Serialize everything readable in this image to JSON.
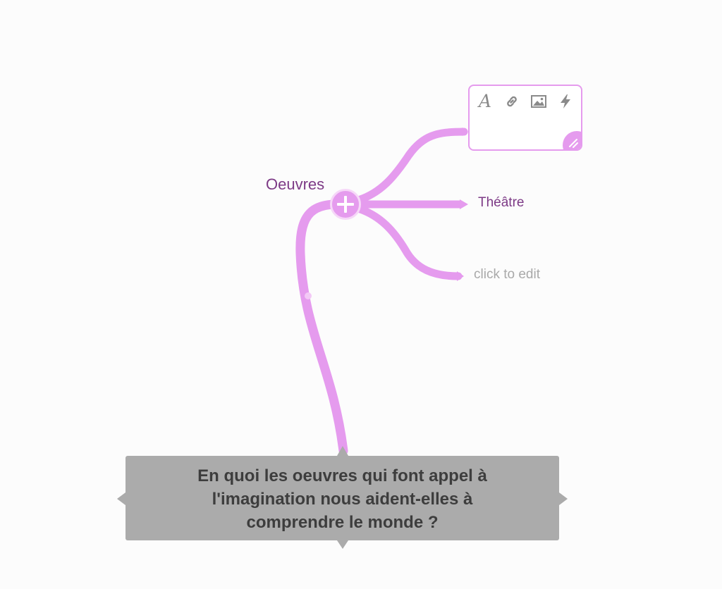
{
  "mindmap": {
    "branch_color": "#e59bee",
    "label_color": "#7d3a86",
    "central_topic": {
      "text": "En quoi les oeuvres qui font appel à\nl'imagination nous aident-elles à\ncomprendre le monde ?",
      "background": "#ababab",
      "text_color": "#3d3d3d"
    },
    "branch": {
      "label": "Oeuvres",
      "expand_icon": "plus-icon",
      "children": [
        {
          "type": "editing",
          "toolbar": [
            {
              "name": "text-style-icon",
              "glyph": "A"
            },
            {
              "name": "link-icon"
            },
            {
              "name": "image-icon"
            },
            {
              "name": "lightning-icon"
            }
          ],
          "resize_icon": "resize-icon"
        },
        {
          "type": "topic",
          "label": "Théâtre"
        },
        {
          "type": "placeholder",
          "label": "click to edit",
          "color": "#a9a9a9"
        }
      ]
    }
  }
}
